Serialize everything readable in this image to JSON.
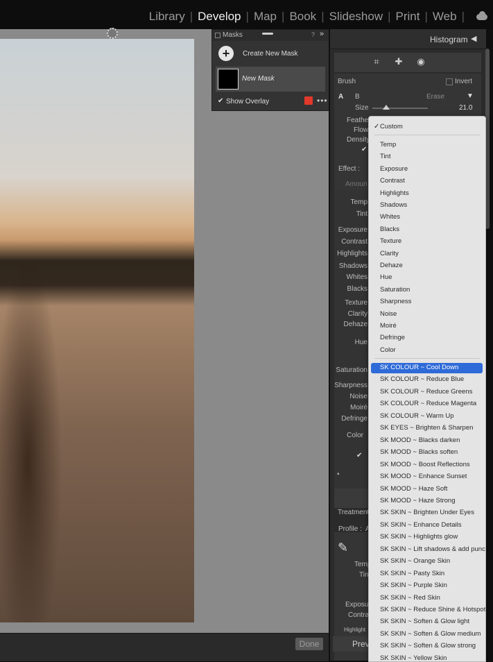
{
  "top_nav": {
    "modules": [
      {
        "label": "Library",
        "active": false
      },
      {
        "label": "Develop",
        "active": true
      },
      {
        "label": "Map",
        "active": false
      },
      {
        "label": "Book",
        "active": false
      },
      {
        "label": "Slideshow",
        "active": false
      },
      {
        "label": "Print",
        "active": false
      },
      {
        "label": "Web",
        "active": false
      }
    ]
  },
  "masks_panel": {
    "title": "Masks",
    "create_label": "Create New Mask",
    "mask_name": "New Mask",
    "show_overlay_label": "Show Overlay",
    "overlay_color": "#e1392b",
    "help_glyph": "?",
    "collapse_glyph": "»",
    "more_glyph": "•••"
  },
  "right_panel": {
    "histogram_label": "Histogram",
    "histogram_arrow": "◀",
    "brush": {
      "title": "Brush",
      "invert_label": "Invert",
      "tab_a": "A",
      "tab_b": "B",
      "erase_label": "Erase",
      "size_label": "Size",
      "size_value": "21.0",
      "size_fraction": 0.25,
      "feather_label": "Feather",
      "flow_label": "Flow",
      "density_label": "Density"
    },
    "effect": {
      "title": "Effect :",
      "amount_label": "Amoun",
      "labels": [
        "Temp",
        "Tint",
        "Exposure",
        "Contrast",
        "Highlights",
        "Shadows",
        "Whites",
        "Blacks",
        "Texture",
        "Clarity",
        "Dehaze",
        "Hue",
        "Saturation",
        "Sharpness",
        "Noise",
        "Moiré",
        "Defringe",
        "Color"
      ]
    },
    "treatment": {
      "title": "Treatment",
      "profile_label": "Profile :",
      "profile_value": "A",
      "temp_label": "Temp",
      "tint_label": "Tin",
      "exposure_label": "Exposure",
      "contrast_label": "Contras",
      "highlights_label": "Highlight"
    },
    "preview_label": "Prev"
  },
  "bottom": {
    "done_label": "Done"
  },
  "dropdown": {
    "selected": "Custom",
    "presets": [
      "Temp",
      "Tint",
      "Exposure",
      "Contrast",
      "Highlights",
      "Shadows",
      "Whites",
      "Blacks",
      "Texture",
      "Clarity",
      "Dehaze",
      "Hue",
      "Saturation",
      "Sharpness",
      "Noise",
      "Moiré",
      "Defringe",
      "Color"
    ],
    "highlighted": "SK COLOUR ~ Cool Down",
    "user_presets": [
      "SK COLOUR ~ Cool Down",
      "SK COLOUR ~ Reduce Blue",
      "SK COLOUR ~ Reduce Greens",
      "SK COLOUR ~ Reduce Magenta",
      "SK COLOUR ~ Warm Up",
      "SK EYES ~ Brighten & Sharpen",
      "SK MOOD ~ Blacks darken",
      "SK MOOD ~ Blacks soften",
      "SK MOOD ~ Boost Reflections",
      "SK MOOD ~ Enhance Sunset",
      "SK MOOD ~ Haze Soft",
      "SK MOOD ~ Haze Strong",
      "SK SKIN ~ Brighten Under Eyes",
      "SK SKIN ~ Enhance Details",
      "SK SKIN ~ Highlights glow",
      "SK SKIN ~ Lift shadows & add punch",
      "SK SKIN ~ Orange Skin",
      "SK SKIN ~ Pasty Skin",
      "SK SKIN ~ Purple Skin",
      "SK SKIN ~ Red Skin",
      "SK SKIN ~ Reduce Shine & Hotspots",
      "SK SKIN ~ Soften & Glow light",
      "SK SKIN ~ Soften & Glow medium",
      "SK SKIN ~ Soften & Glow strong",
      "SK SKIN ~ Yellow Skin"
    ]
  },
  "colors": {
    "accent": "#2f6bd8",
    "panel": "#2b2b2b",
    "workspace": "#8a8a8a"
  }
}
